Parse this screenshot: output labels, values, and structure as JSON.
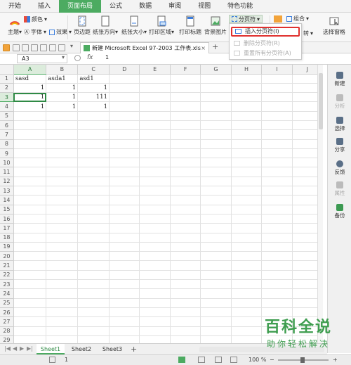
{
  "menu": {
    "tabs": [
      "开始",
      "插入",
      "页面布局",
      "公式",
      "数据",
      "审阅",
      "视图",
      "特色功能"
    ],
    "active_index": 2
  },
  "ribbon": {
    "theme_label": "主题",
    "color_label": "颜色",
    "font_label": "字体",
    "effect_label": "效果",
    "margin_label": "页边距",
    "orientation_label": "纸张方向",
    "size_label": "纸张大小",
    "print_area_label": "打印区域",
    "print_title_label": "打印标题",
    "background_label": "背景图片",
    "page_break_label": "分页符",
    "combine_label": "组合",
    "rotate_label": "转",
    "select_pane_label": "选择窗格"
  },
  "page_break_menu": {
    "items": [
      {
        "label": "插入分页符(I)",
        "enabled": true
      },
      {
        "label": "删除分页符(R)",
        "enabled": false
      },
      {
        "label": "重置所有分页符(A)",
        "enabled": false
      }
    ]
  },
  "document": {
    "tab_title": "新建 Microsoft Excel 97-2003 工作表.xls",
    "close_glyph": "×",
    "add_glyph": "+"
  },
  "formula": {
    "cell_ref": "A3",
    "fx_label": "fx",
    "value": "1"
  },
  "grid": {
    "columns": [
      "A",
      "B",
      "C",
      "D",
      "E",
      "F",
      "G",
      "H",
      "I",
      "J"
    ],
    "active_column": "A",
    "row_count": 29,
    "active_row": 3,
    "cells": {
      "1": [
        "sasd",
        "asda1",
        "asd1"
      ],
      "2": [
        "1",
        "1",
        "1"
      ],
      "3": [
        "1",
        "1",
        "111"
      ],
      "4": [
        "1",
        "1",
        "1"
      ]
    }
  },
  "side_panel": {
    "items": [
      {
        "label": "新建",
        "enabled": true
      },
      {
        "label": "分析",
        "enabled": false
      },
      {
        "label": "选择",
        "enabled": true
      },
      {
        "label": "分享",
        "enabled": true
      },
      {
        "label": "反馈",
        "enabled": true
      },
      {
        "label": "属性",
        "enabled": false
      },
      {
        "label": "备份",
        "enabled": true
      }
    ]
  },
  "sheets": {
    "tabs": [
      "Sheet1",
      "Sheet2",
      "Sheet3"
    ],
    "active_index": 0,
    "add_glyph": "+"
  },
  "status": {
    "value": "1",
    "zoom": "100 %"
  },
  "watermark": {
    "main": "百科全说",
    "sub": "助你轻松解决"
  },
  "colors": {
    "accent": "#4cab61",
    "highlight_border": "#e0312e"
  }
}
